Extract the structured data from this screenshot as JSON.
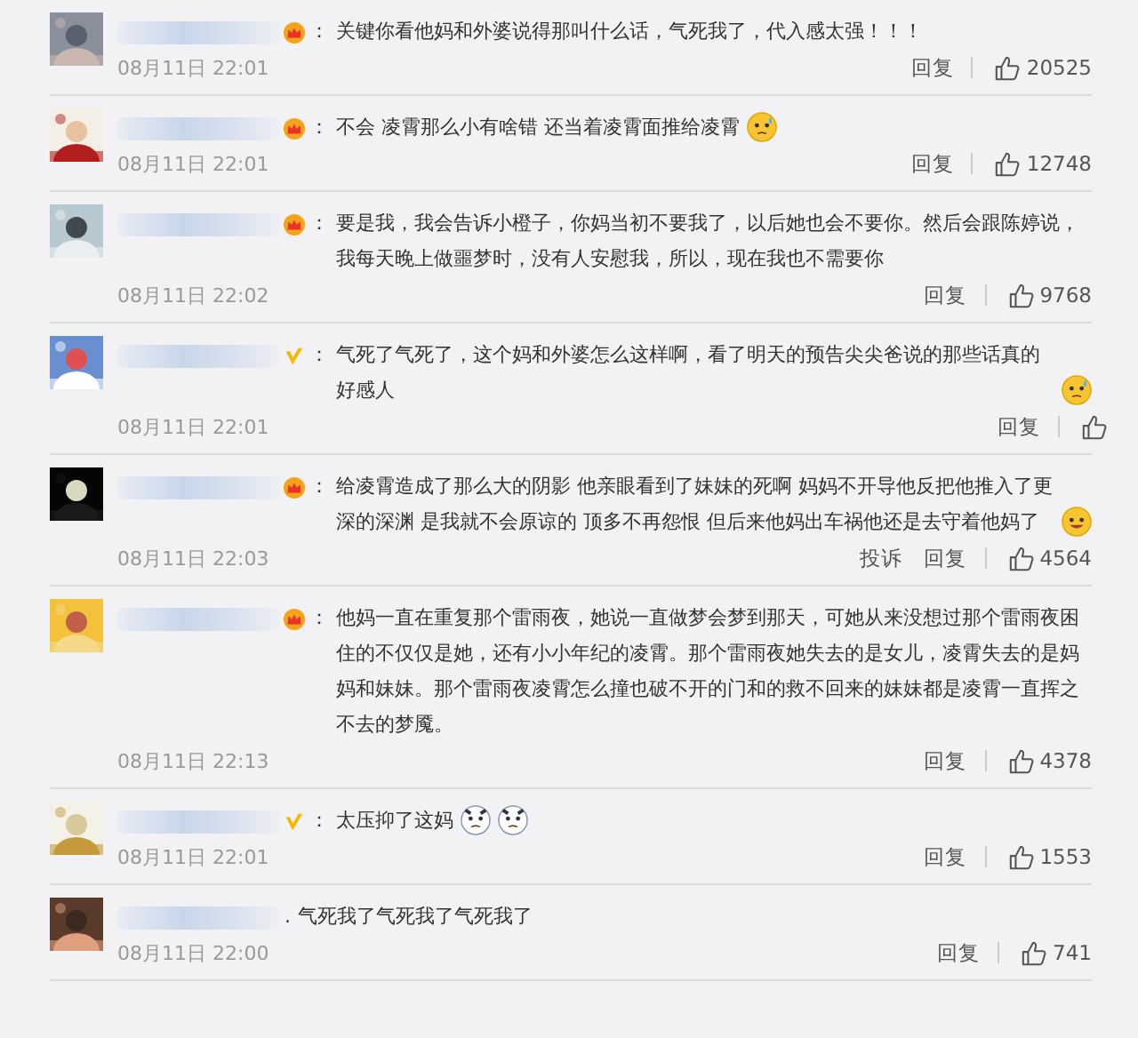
{
  "comments": [
    {
      "badge": {
        "kind": "crown"
      },
      "separator": "：",
      "text": "关键你看他妈和外婆说得那叫什么话，气死我了，代入感太强！！！",
      "time": "08月11日 22:01",
      "actions": [
        "回复"
      ],
      "likes": "20525"
    },
    {
      "badge": {
        "kind": "crown"
      },
      "separator": "：",
      "text": "不会 凌霄那么小有啥错 还当着凌霄面推给凌霄",
      "emojis": [
        {
          "kind": "sweat"
        }
      ],
      "time": "08月11日 22:01",
      "actions": [
        "回复"
      ],
      "likes": "12748"
    },
    {
      "badge": {
        "kind": "crown"
      },
      "separator": "：",
      "text": "要是我，我会告诉小橙子，你妈当初不要我了，以后她也会不要你。然后会跟陈婷说，我每天晚上做噩梦时，没有人安慰我，所以，现在我也不需要你",
      "time": "08月11日 22:02",
      "actions": [
        "回复"
      ],
      "likes": "9768"
    },
    {
      "badge": {
        "kind": "vip"
      },
      "separator": "：",
      "text": "气死了气死了，这个妈和外婆怎么这样啊，看了明天的预告尖尖爸说的那些话真的好感人",
      "emojis": [
        {
          "kind": "cry"
        }
      ],
      "time": "08月11日 22:01",
      "actions": [
        "回复"
      ]
    },
    {
      "badge": {
        "kind": "crown"
      },
      "separator": "：",
      "text": "给凌霄造成了那么大的阴影 他亲眼看到了妹妹的死啊 妈妈不开导他反把他推入了更深的深渊 是我就不会原谅的 顶多不再怨恨 但后来他妈出车祸他还是去守着他妈了",
      "emojis": [
        {
          "kind": "laugh"
        }
      ],
      "time": "08月11日 22:03",
      "actions": [
        "投诉",
        "回复"
      ],
      "likes": "4564"
    },
    {
      "badge": {
        "kind": "crown"
      },
      "separator": "：",
      "text": "他妈一直在重复那个雷雨夜，她说一直做梦会梦到那天，可她从来没想过那个雷雨夜困住的不仅仅是她，还有小小年纪的凌霄。那个雷雨夜她失去的是女儿，凌霄失去的是妈妈和妹妹。那个雷雨夜凌霄怎么撞也破不开的门和的救不回来的妹妹都是凌霄一直挥之不去的梦魇。",
      "time": "08月11日 22:13",
      "actions": [
        "回复"
      ],
      "likes": "4378"
    },
    {
      "badge": {
        "kind": "vip"
      },
      "separator": "：",
      "text": "太压抑了这妈",
      "emojis": [
        {
          "kind": "panda"
        },
        {
          "kind": "panda"
        }
      ],
      "time": "08月11日 22:01",
      "actions": [
        "回复"
      ],
      "likes": "1553"
    },
    {
      "separator": ".",
      "text": "气死我了气死我了气死我了",
      "time": "08月11日 22:00",
      "actions": [
        "回复"
      ],
      "likes": "741"
    }
  ]
}
